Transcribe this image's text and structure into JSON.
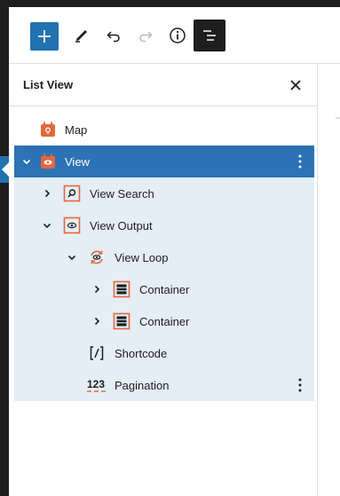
{
  "toolbar": {
    "add_icon": "plus-icon",
    "pencil_icon": "pencil-icon",
    "undo_icon": "undo-icon",
    "redo_icon": "redo-icon",
    "info_icon": "info-icon",
    "list_view_icon": "list-view-icon",
    "accent_color": "#2271b1"
  },
  "panel": {
    "title": "List View",
    "close_icon": "close-icon"
  },
  "tree": {
    "items": [
      {
        "label": "Map",
        "icon": "map-block-icon",
        "level": 0,
        "expanded": null,
        "selected": false
      },
      {
        "label": "View",
        "icon": "view-block-icon",
        "level": 0,
        "expanded": true,
        "selected": true
      },
      {
        "label": "View Search",
        "icon": "search-block-icon",
        "level": 1,
        "expanded": false,
        "selected": false
      },
      {
        "label": "View Output",
        "icon": "eye-block-icon",
        "level": 1,
        "expanded": true,
        "selected": false
      },
      {
        "label": "View Loop",
        "icon": "loop-icon",
        "level": 2,
        "expanded": true,
        "selected": false
      },
      {
        "label": "Container",
        "icon": "container-icon",
        "level": 3,
        "expanded": false,
        "selected": false
      },
      {
        "label": "Container",
        "icon": "container-icon",
        "level": 3,
        "expanded": false,
        "selected": false
      },
      {
        "label": "Shortcode",
        "icon": "shortcode-icon",
        "level": 2,
        "expanded": null,
        "selected": false
      },
      {
        "label": "Pagination",
        "icon": "pagination-icon",
        "level": 2,
        "expanded": null,
        "selected": false
      }
    ],
    "selected_color": "#2c72b5",
    "child_bg_color": "#e5eef5",
    "block_icon_color": "#e2683d"
  }
}
